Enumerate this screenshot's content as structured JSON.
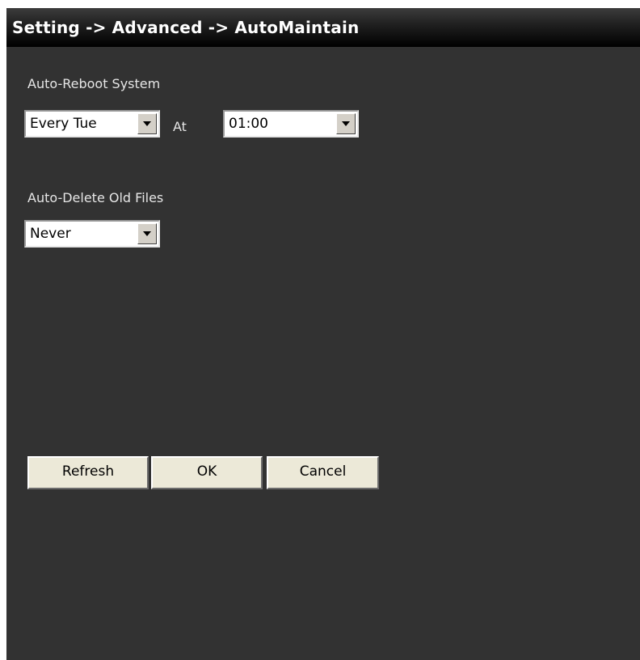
{
  "window": {
    "title": "Setting -> Advanced -> AutoMaintain"
  },
  "auto_reboot": {
    "label": "Auto-Reboot System",
    "frequency_value": "Every Tue",
    "at_label": "At",
    "time_value": "01:00"
  },
  "auto_delete": {
    "label": "Auto-Delete Old Files",
    "value": "Never"
  },
  "buttons": {
    "refresh": "Refresh",
    "ok": "OK",
    "cancel": "Cancel"
  },
  "icons": {
    "dropdown": "chevron-down-icon"
  },
  "colors": {
    "panel_background": "#323232",
    "titlebar": "#000000",
    "button_face": "#ece9d8"
  }
}
